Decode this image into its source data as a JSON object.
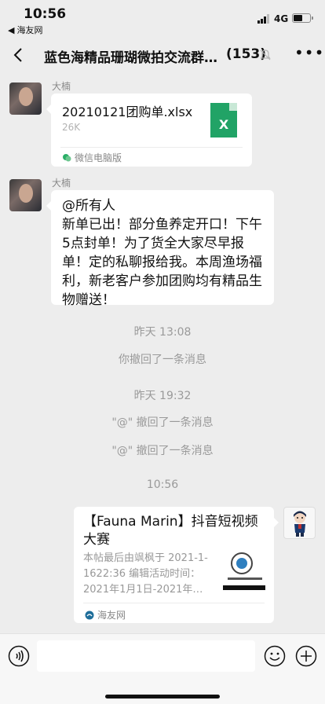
{
  "status_bar": {
    "time": "10:56",
    "back_app": "海友网",
    "network": "4G"
  },
  "header": {
    "title": "蓝色海精品珊瑚微拍交流群…",
    "count": "(153)"
  },
  "messages": {
    "file": {
      "sender": "大楠",
      "file_name": "20210121团购单.xlsx",
      "file_size": "26K",
      "file_icon_letter": "X",
      "source": "微信电脑版"
    },
    "text": {
      "sender": "大楠",
      "body": "@所有人\n新单已出！部分鱼养定开口！下午5点封单！为了货全大家尽早报单！定的私聊报给我。本周渔场福利，新老客户参加团购均有精品生物赠送！"
    },
    "sys": [
      {
        "time": "昨天 13:08",
        "text": "你撤回了一条消息"
      },
      {
        "time": "昨天 19:32",
        "text1": "\"@\" 撤回了一条消息",
        "text2": "\"@\" 撤回了一条消息"
      },
      {
        "time": "10:56"
      }
    ],
    "link": {
      "title": "【Fauna Marin】抖音短视频大赛",
      "desc": "本帖最后由飒枫于 2021-1-1622:36 编辑活动时间：2021年1月1日-2021年…",
      "source": "海友网"
    }
  },
  "colors": {
    "excel_green": "#21a366",
    "chat_bg": "#ededed"
  }
}
